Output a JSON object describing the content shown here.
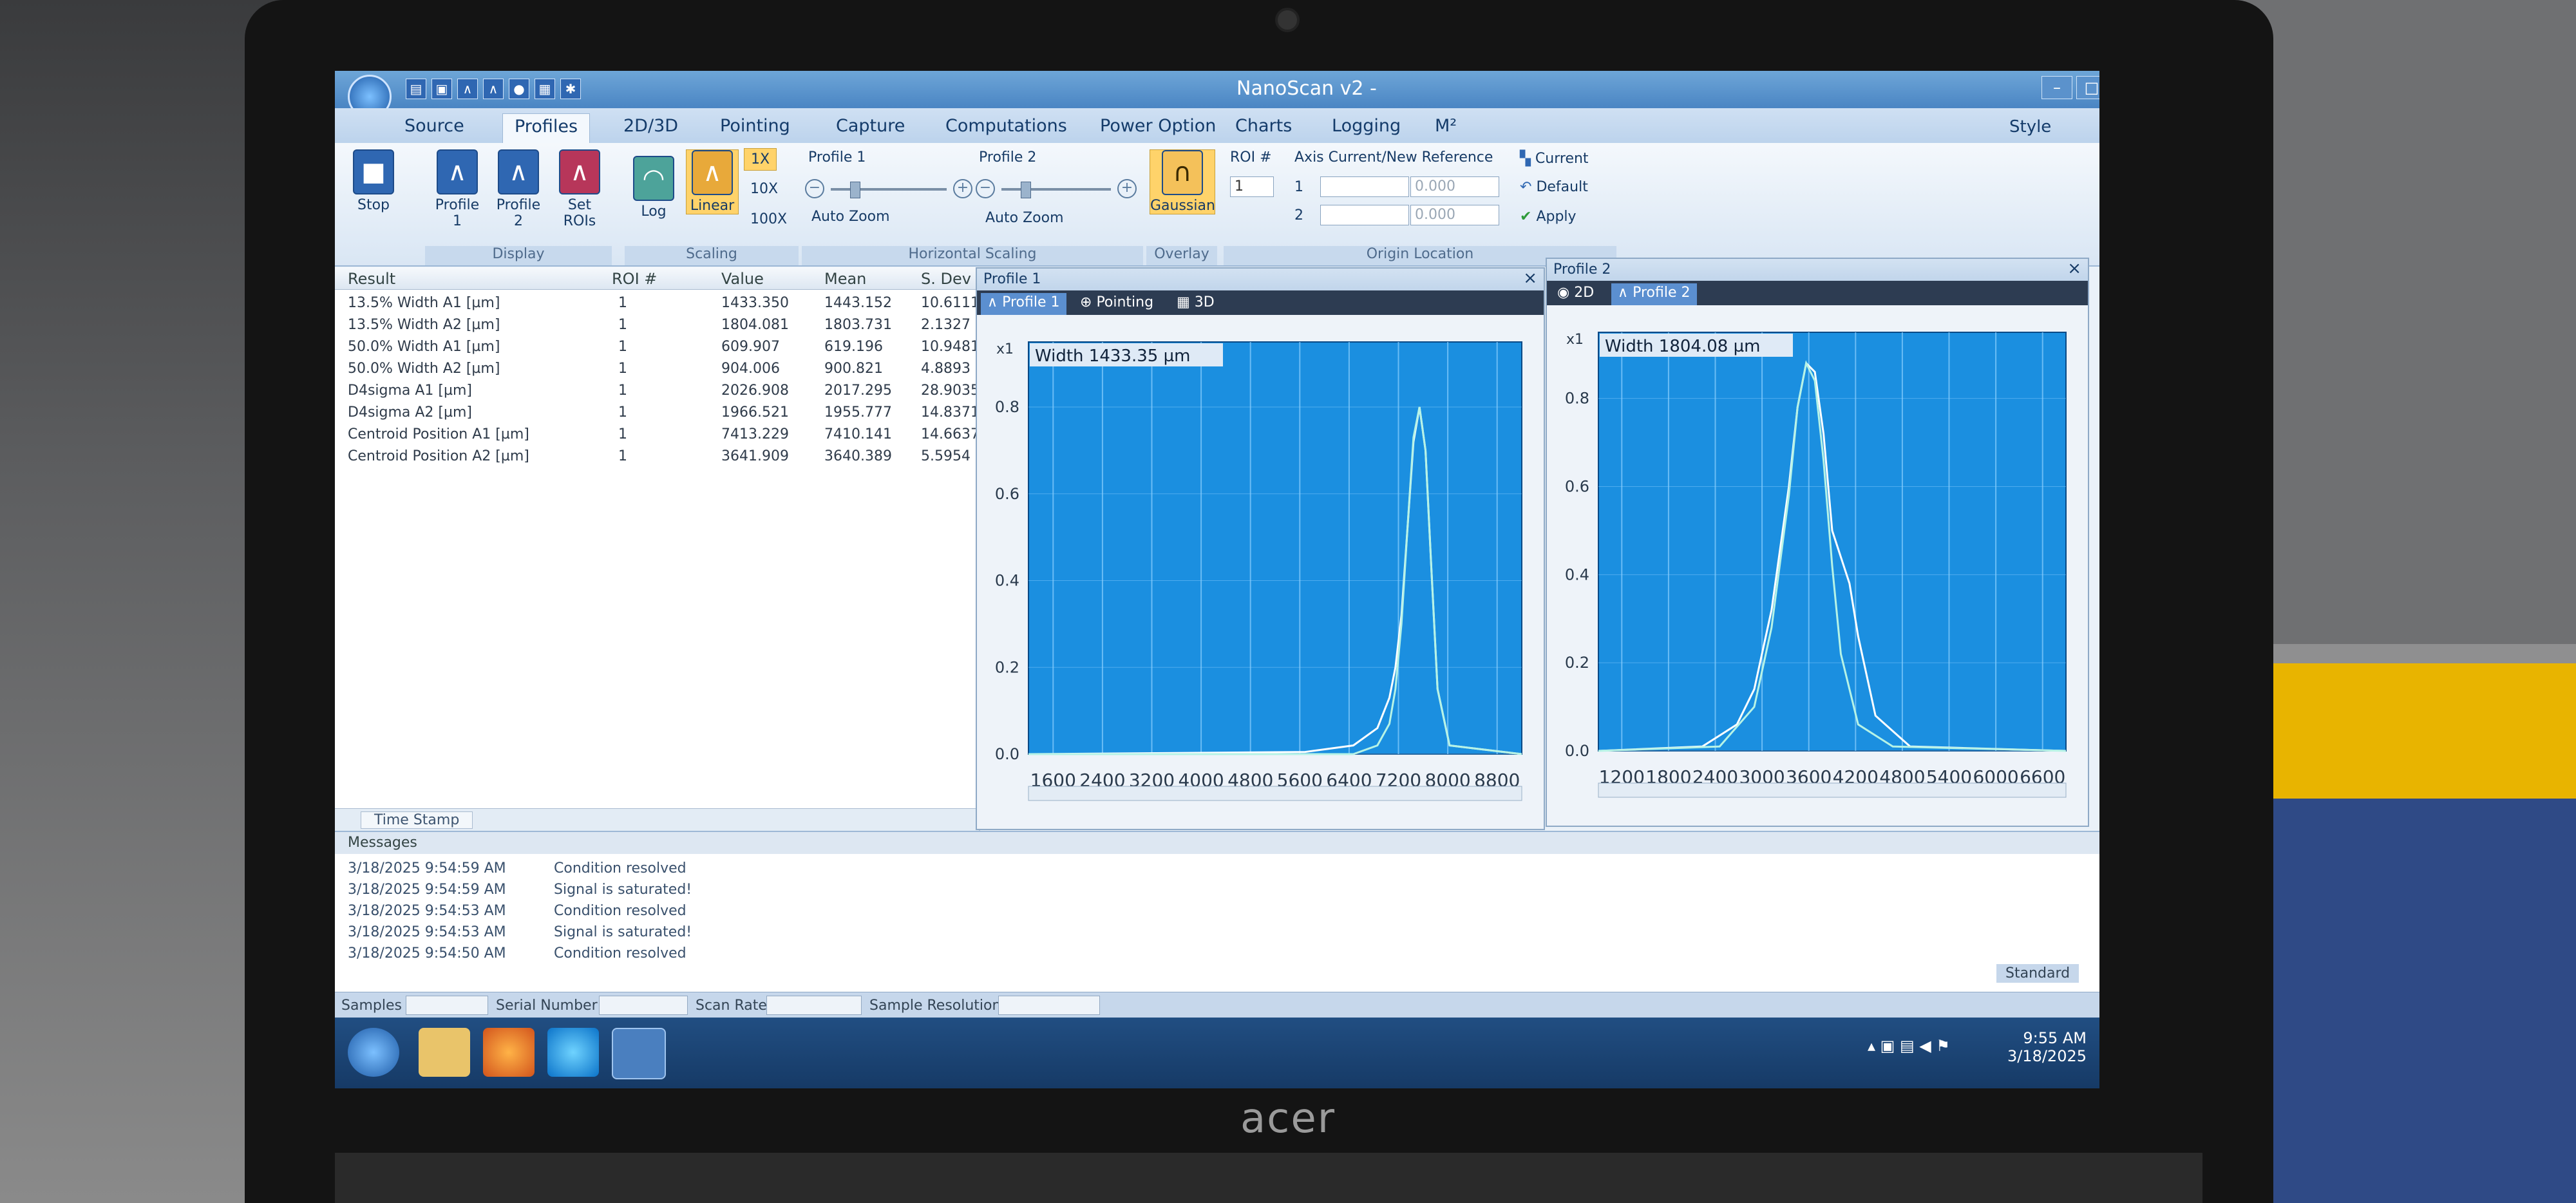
{
  "app": {
    "title": "NanoScan v2 -",
    "style_label": "Style",
    "window_buttons": {
      "minimize": "–",
      "maximize": "□",
      "close": "✕"
    }
  },
  "tabs": [
    "Source",
    "Profiles",
    "2D/3D",
    "Pointing",
    "Capture",
    "Computations",
    "Power Option",
    "Charts",
    "Logging",
    "M²"
  ],
  "active_tab": "Profiles",
  "ribbon": {
    "stop_label": "Stop",
    "display": {
      "group_label": "Display",
      "profile1": "Profile 1",
      "profile2": "Profile 2",
      "set_rois": "Set ROIs"
    },
    "scaling": {
      "group_label": "Scaling",
      "log": "Log",
      "linear": "Linear",
      "zoom": [
        "1X",
        "10X",
        "100X"
      ]
    },
    "horizontal_scaling": {
      "group_label": "Horizontal Scaling",
      "profile1_label": "Profile 1",
      "profile2_label": "Profile 2",
      "auto_zoom": "Auto Zoom"
    },
    "overlay": {
      "group_label": "Overlay",
      "gaussian": "Gaussian"
    },
    "origin": {
      "group_label": "Origin Location",
      "roi_label": "ROI #",
      "roi_value": "1",
      "axis_label": "Axis Current/New Reference",
      "axis1": "1",
      "axis2": "2",
      "value1": "0.000",
      "value2": "0.000",
      "current": "Current",
      "default": "Default",
      "apply": "Apply"
    }
  },
  "results": {
    "headers": [
      "Result",
      "ROI #",
      "Value",
      "Mean",
      "S. Dev"
    ],
    "rows": [
      [
        "13.5% Width A1 [µm]",
        "1",
        "1433.350",
        "1443.152",
        "10.6111"
      ],
      [
        "13.5% Width A2 [µm]",
        "1",
        "1804.081",
        "1803.731",
        "2.1327"
      ],
      [
        "50.0% Width A1 [µm]",
        "1",
        "609.907",
        "619.196",
        "10.9481"
      ],
      [
        "50.0% Width A2 [µm]",
        "1",
        "904.006",
        "900.821",
        "4.8893"
      ],
      [
        "D4sigma A1 [µm]",
        "1",
        "2026.908",
        "2017.295",
        "28.9035"
      ],
      [
        "D4sigma A2 [µm]",
        "1",
        "1966.521",
        "1955.777",
        "14.8371"
      ],
      [
        "Centroid Position A1 [µm]",
        "1",
        "7413.229",
        "7410.141",
        "14.6637"
      ],
      [
        "Centroid Position A2 [µm]",
        "1",
        "3641.909",
        "3640.389",
        "5.5954"
      ]
    ],
    "time_stamp_label": "Time Stamp"
  },
  "profile1_window": {
    "title": "Profile 1",
    "tabs": [
      "Profile 1",
      "Pointing",
      "3D"
    ],
    "scale": "x1",
    "width_label": "Width 1433.35 µm"
  },
  "profile2_window": {
    "title": "Profile 2",
    "tabs": [
      "2D",
      "Profile 2"
    ],
    "scale": "x1",
    "width_label": "Width 1804.08 µm"
  },
  "chart_data": [
    {
      "type": "line",
      "x_ticks": [
        "1600",
        "2400",
        "3200",
        "4000",
        "4800",
        "5600",
        "6400",
        "7200",
        "8000",
        "8800"
      ],
      "y_ticks": [
        "0.0",
        "0.2",
        "0.4",
        "0.6",
        "0.8"
      ],
      "xlim": [
        1000,
        9200
      ],
      "ylim": [
        0,
        0.95
      ],
      "grid": true,
      "series": [
        {
          "x": [
            1000,
            5600,
            6400,
            6800,
            7000,
            7100,
            7200,
            7300,
            7400,
            7500,
            7600,
            7700,
            7800,
            8000,
            9200
          ],
          "y": [
            0.0,
            0.005,
            0.02,
            0.06,
            0.13,
            0.2,
            0.32,
            0.52,
            0.72,
            0.8,
            0.7,
            0.42,
            0.15,
            0.02,
            0.0
          ]
        },
        {
          "x": [
            1000,
            6400,
            6800,
            7000,
            7100,
            7200,
            7300,
            7400,
            7500,
            7600,
            7700,
            7800,
            8000,
            9200
          ],
          "y": [
            0.0,
            0.0,
            0.02,
            0.07,
            0.15,
            0.3,
            0.52,
            0.73,
            0.8,
            0.7,
            0.42,
            0.15,
            0.02,
            0.0
          ]
        }
      ]
    },
    {
      "type": "line",
      "x_ticks": [
        "1200",
        "1800",
        "2400",
        "3000",
        "3600",
        "4200",
        "4800",
        "5400",
        "6000",
        "6600"
      ],
      "y_ticks": [
        "0.0",
        "0.2",
        "0.4",
        "0.6",
        "0.8"
      ],
      "xlim": [
        1200,
        6600
      ],
      "ylim": [
        0,
        0.95
      ],
      "grid": true,
      "series": [
        {
          "x": [
            1200,
            2400,
            2800,
            3000,
            3200,
            3400,
            3500,
            3600,
            3700,
            3800,
            3900,
            4000,
            4100,
            4200,
            4400,
            4800,
            6600
          ],
          "y": [
            0.0,
            0.01,
            0.06,
            0.14,
            0.32,
            0.6,
            0.78,
            0.88,
            0.86,
            0.72,
            0.5,
            0.44,
            0.38,
            0.26,
            0.08,
            0.01,
            0.0
          ]
        },
        {
          "x": [
            1200,
            2600,
            3000,
            3200,
            3400,
            3500,
            3600,
            3700,
            3800,
            3900,
            4000,
            4200,
            4600,
            6600
          ],
          "y": [
            0.0,
            0.01,
            0.1,
            0.28,
            0.58,
            0.78,
            0.88,
            0.84,
            0.66,
            0.42,
            0.22,
            0.06,
            0.01,
            0.0
          ]
        }
      ]
    }
  ],
  "messages": {
    "header": "Messages",
    "rows": [
      [
        "3/18/2025 9:54:59 AM",
        "Condition resolved"
      ],
      [
        "3/18/2025 9:54:59 AM",
        "Signal is saturated!"
      ],
      [
        "3/18/2025 9:54:53 AM",
        "Condition resolved"
      ],
      [
        "3/18/2025 9:54:53 AM",
        "Signal is saturated!"
      ],
      [
        "3/18/2025 9:54:50 AM",
        "Condition resolved"
      ]
    ],
    "standard": "Standard"
  },
  "statusbar": {
    "samples": "Samples",
    "serial": "Serial Number",
    "scan_rate": "Scan Rate",
    "sample_res": "Sample Resolution"
  },
  "taskbar": {
    "time": "9:55 AM",
    "date": "3/18/2025"
  },
  "laptop": {
    "brand": "acer"
  }
}
